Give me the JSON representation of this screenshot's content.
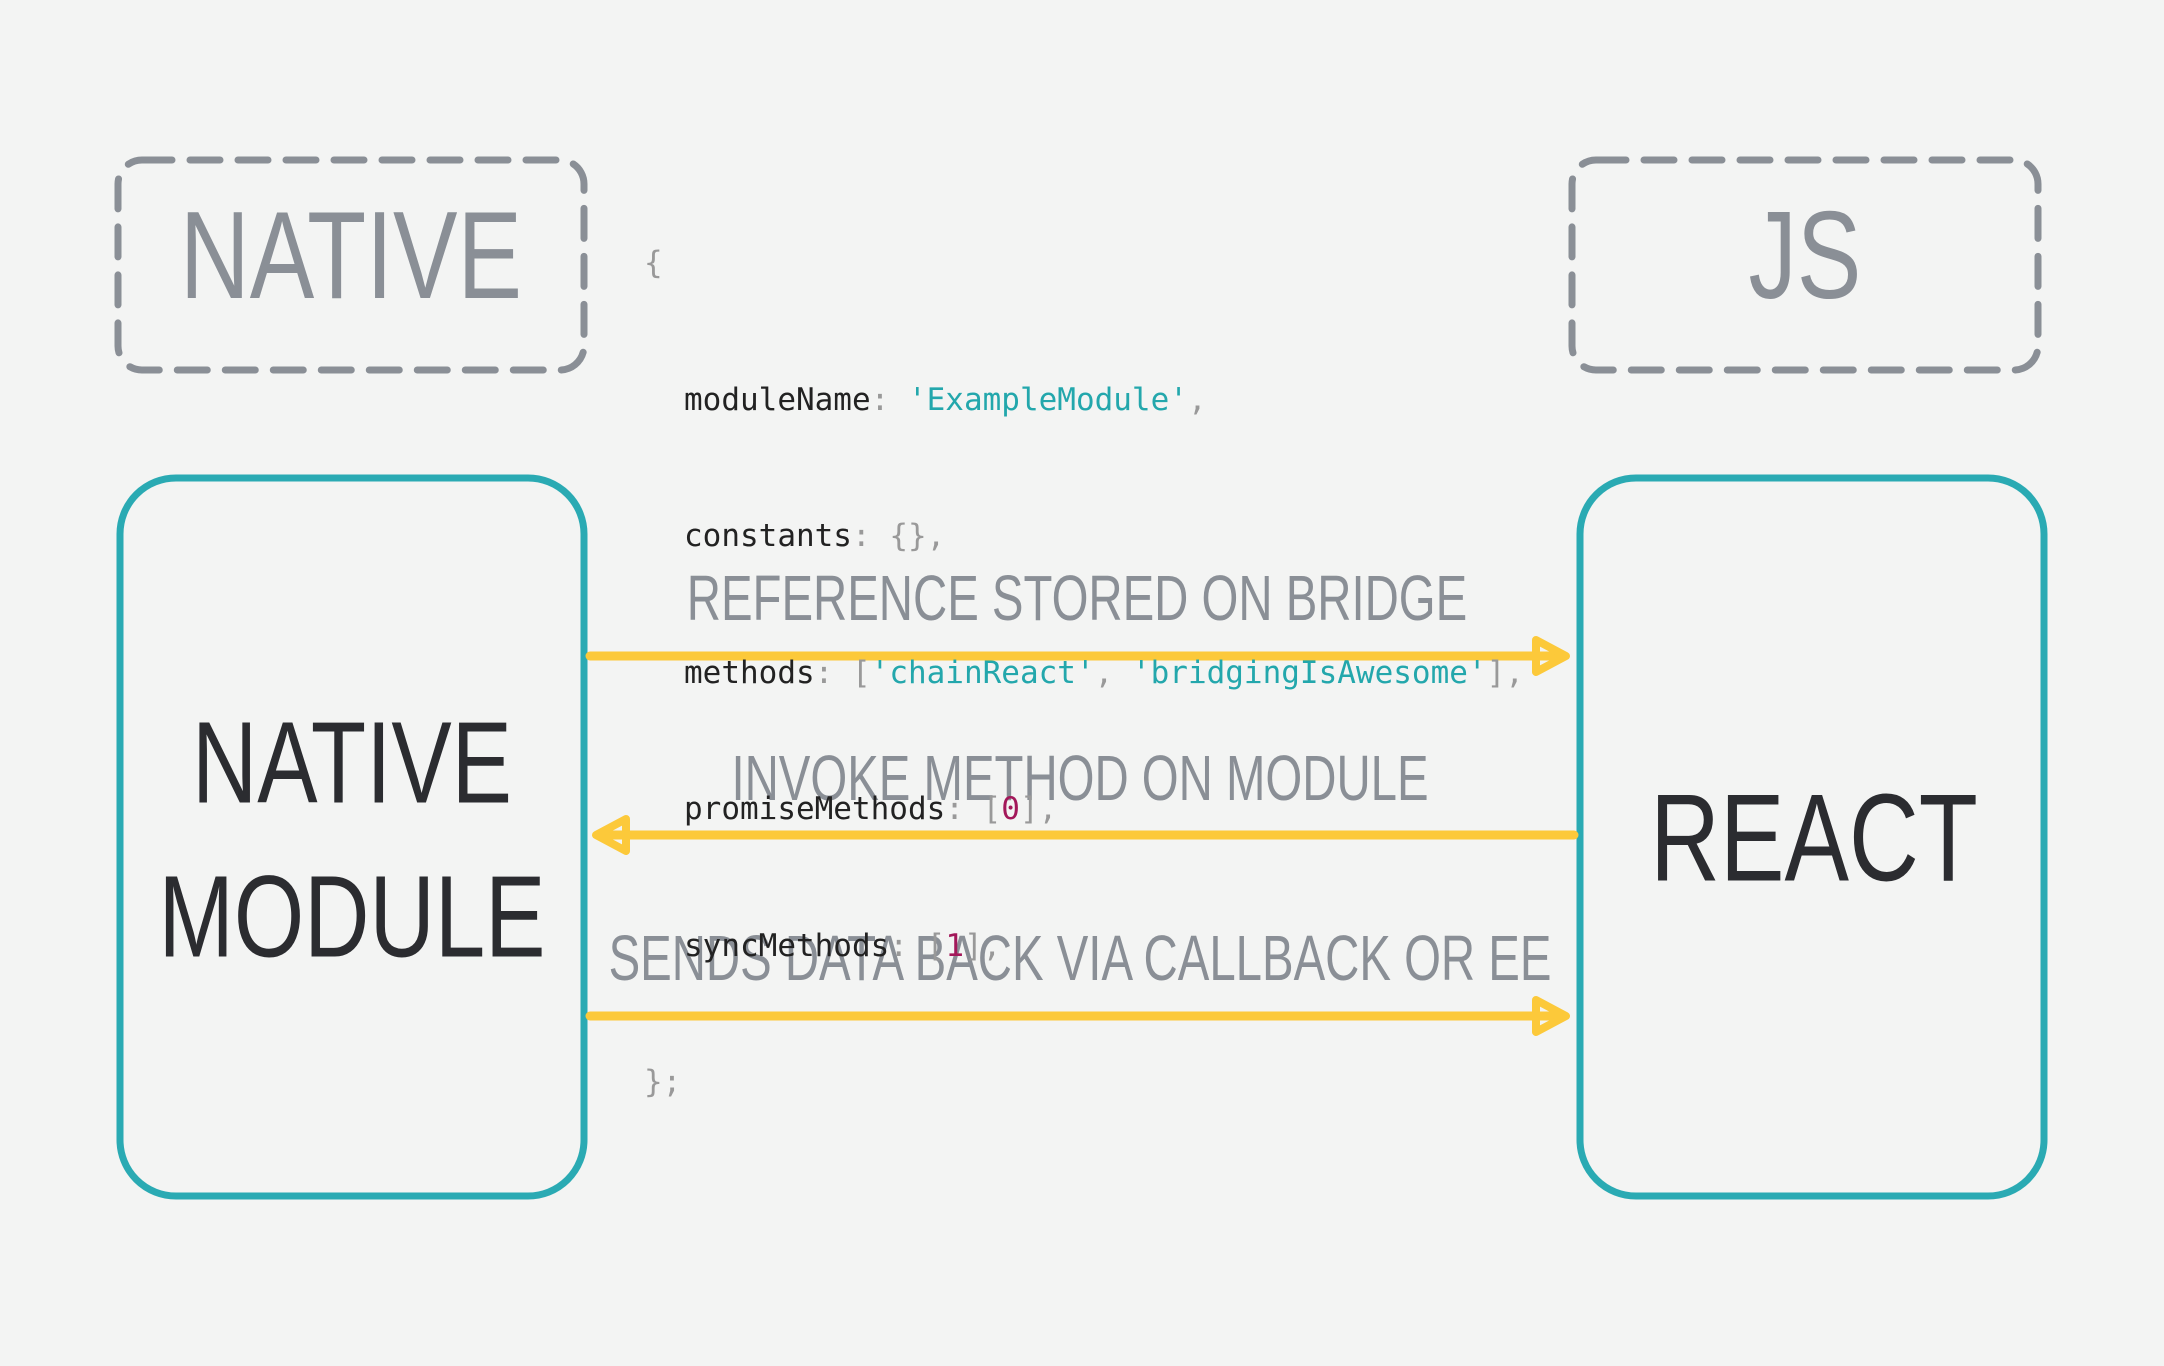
{
  "colors": {
    "background": "#f3f4f3",
    "dashed_box": "#8a8f96",
    "module_box": "#2aaab3",
    "arrow": "#fcc93a",
    "heading_text": "#8a8f96",
    "box_text": "#2b2c30",
    "code_key": "#222222",
    "code_string": "#23a7ac",
    "code_number": "#a3185a",
    "code_punct": "#999999"
  },
  "headers": {
    "left": "NATIVE",
    "right": "JS"
  },
  "boxes": {
    "left_line1": "NATIVE",
    "left_line2": "MODULE",
    "right": "REACT"
  },
  "arrows": [
    {
      "label": "REFERENCE STORED ON BRIDGE",
      "direction": "to-right"
    },
    {
      "label": "INVOKE METHOD ON MODULE",
      "direction": "to-left"
    },
    {
      "label": "SENDS DATA BACK VIA CALLBACK OR EE",
      "direction": "to-right"
    }
  ],
  "code": {
    "open": "{",
    "module_name_key": "moduleName",
    "module_name_value": "'ExampleModule'",
    "constants_key": "constants",
    "constants_value": "{}",
    "methods_key": "methods",
    "methods_values": [
      "'chainReact'",
      "'bridgingIsAwesome'"
    ],
    "promise_methods_key": "promiseMethods",
    "promise_methods_value": "0",
    "sync_methods_key": "syncMethods",
    "sync_methods_value": "1",
    "close": "};"
  }
}
